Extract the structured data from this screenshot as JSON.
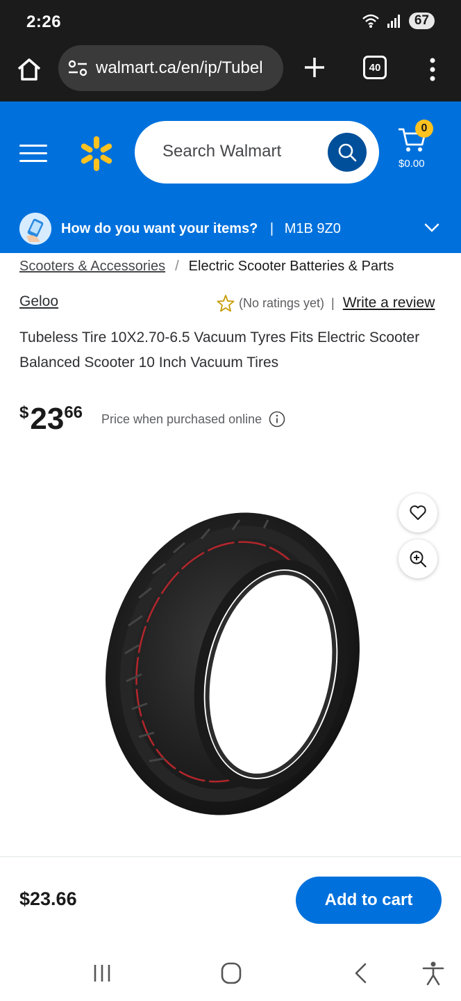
{
  "status_bar": {
    "time": "2:26",
    "battery": "67"
  },
  "browser": {
    "url": "walmart.ca/en/ip/Tubel",
    "tab_count": "40"
  },
  "header": {
    "search_placeholder": "Search Walmart",
    "cart_count": "0",
    "cart_total": "$0.00"
  },
  "delivery": {
    "question": "How do you want your items?",
    "separator": "|",
    "postal_code": "M1B 9Z0"
  },
  "breadcrumb": {
    "parent": "Scooters & Accessories",
    "separator": "/",
    "current": "Electric Scooter Batteries & Parts"
  },
  "product": {
    "brand": "Geloo",
    "ratings": "(No ratings yet)",
    "ratings_divider": "|",
    "write_review": "Write a review",
    "title": "Tubeless Tire 10X2.70-6.5 Vacuum Tyres Fits Electric Scooter Balanced Scooter 10 Inch Vacuum Tires",
    "price_currency": "$",
    "price_dollars": "23",
    "price_cents": "66",
    "price_note": "Price when purchased online"
  },
  "footer": {
    "price": "$23.66",
    "add_to_cart": "Add to cart"
  },
  "colors": {
    "brand_blue": "#0071dc",
    "spark_yellow": "#ffc220",
    "dark_blue": "#004f9a"
  }
}
